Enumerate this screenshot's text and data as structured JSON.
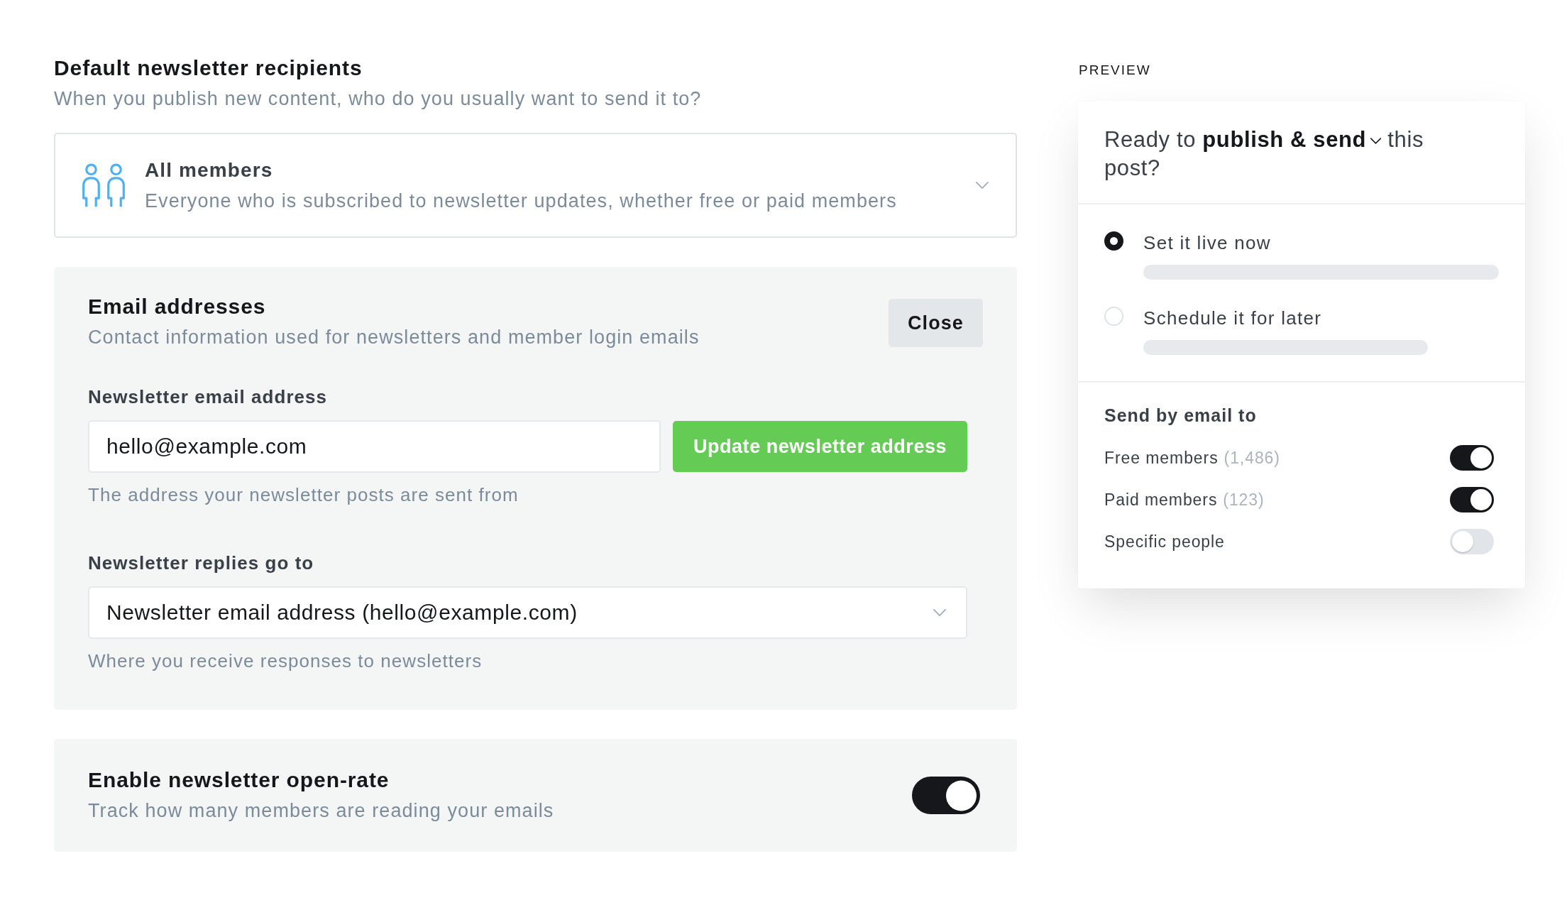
{
  "recipients": {
    "title": "Default newsletter recipients",
    "description": "When you publish new content, who do you usually want to send it to?",
    "selection": {
      "label": "All members",
      "description": "Everyone who is subscribed to newsletter updates, whether free or paid members"
    }
  },
  "email_addresses": {
    "title": "Email addresses",
    "description": "Contact information used for newsletters and member login emails",
    "close_button": "Close",
    "fields": [
      {
        "kind": "input",
        "label": "Newsletter email address",
        "value": "hello@example.com",
        "button": "Update newsletter address",
        "hint": "The address your newsletter posts are sent from"
      },
      {
        "kind": "select",
        "label": "Newsletter replies go to",
        "value": "Newsletter email address (hello@example.com)",
        "hint": "Where you receive responses to newsletters"
      }
    ]
  },
  "open_rate": {
    "title": "Enable newsletter open-rate",
    "description": "Track how many members are reading your emails",
    "on": true
  },
  "preview": {
    "label": "PREVIEW",
    "prompt": {
      "before": "Ready to",
      "action": "publish & send",
      "after": "this post?"
    },
    "options": [
      {
        "label": "Set it live now",
        "selected": true
      },
      {
        "label": "Schedule it for later",
        "selected": false
      }
    ],
    "send": {
      "title": "Send by email to",
      "audiences": [
        {
          "label": "Free members",
          "count": "(1,486)",
          "on": true
        },
        {
          "label": "Paid members",
          "count": "(123)",
          "on": true
        },
        {
          "label": "Specific people",
          "on": false
        }
      ]
    }
  }
}
